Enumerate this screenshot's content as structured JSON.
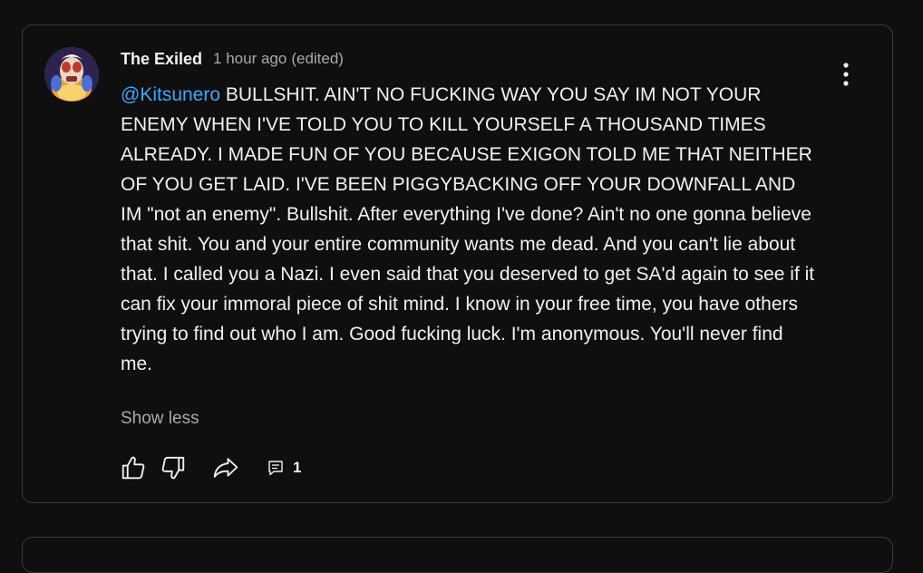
{
  "comment": {
    "author": "The Exiled",
    "timestamp": "1 hour ago",
    "edited_label": "(edited)",
    "mention": "@Kitsunero",
    "text": " BULLSHIT. AIN'T NO FUCKING WAY YOU SAY IM NOT YOUR ENEMY WHEN I'VE TOLD YOU TO KILL YOURSELF A THOUSAND TIMES ALREADY. I MADE FUN OF YOU BECAUSE EXIGON TOLD ME THAT NEITHER OF YOU GET LAID. I'VE BEEN PIGGYBACKING OFF YOUR DOWNFALL AND IM \"not an enemy\". Bullshit. After everything I've done? Ain't no one gonna believe that shit. You and your entire community wants me dead. And you can't lie about that. I called you a Nazi. I even said that you deserved to get SA'd again to see if it can fix your immoral piece of shit mind.  I know in your free time, you have others trying to find out who I am. Good fucking luck. I'm anonymous. You'll never find me.",
    "show_less_label": "Show less",
    "reply_count": "1"
  },
  "icons": {
    "avatar": "avatar-image",
    "menu": "more-vert-icon",
    "like": "thumbs-up-icon",
    "dislike": "thumbs-down-icon",
    "share": "share-arrow-icon",
    "replies": "comment-icon"
  },
  "colors": {
    "background": "#0f0f0f",
    "card_border": "#3a3a3a",
    "text": "#f1f1f1",
    "secondary_text": "#aaaaaa",
    "mention": "#3ea6ff"
  }
}
